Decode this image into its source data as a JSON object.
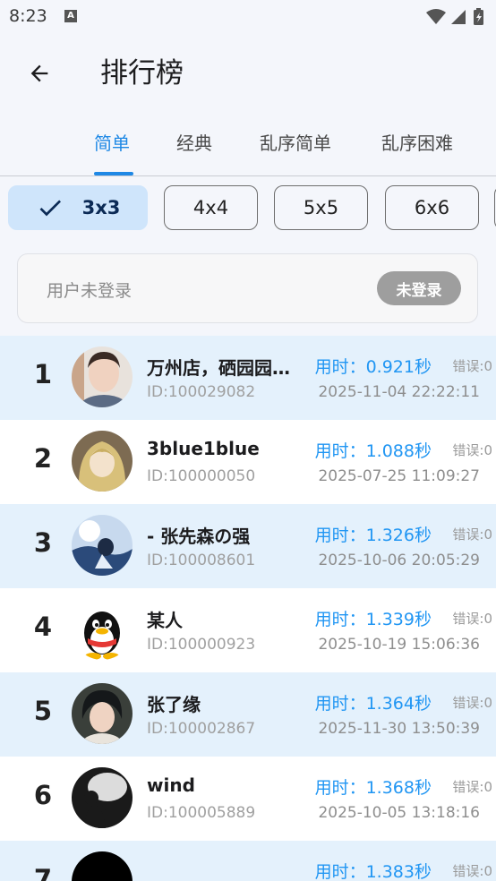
{
  "status_bar": {
    "time": "8:23",
    "notification_icon": "a-icon"
  },
  "header": {
    "title": "排行榜",
    "back_icon": "arrow-left-icon"
  },
  "tabs": [
    {
      "label": "简单",
      "active": true
    },
    {
      "label": "经典",
      "active": false
    },
    {
      "label": "乱序简单",
      "active": false
    },
    {
      "label": "乱序困难",
      "active": false
    }
  ],
  "sizes": [
    {
      "label": "3x3",
      "selected": true
    },
    {
      "label": "4x4",
      "selected": false
    },
    {
      "label": "5x5",
      "selected": false
    },
    {
      "label": "6x6",
      "selected": false
    }
  ],
  "login": {
    "text": "用户未登录",
    "button_label": "未登录"
  },
  "leaderboard": [
    {
      "rank": "1",
      "name": "万州店，硒园园…",
      "id": "ID:100029082",
      "time": "用时：0.921秒",
      "errors": "错误:0",
      "date": "2025-11-04 22:22:11"
    },
    {
      "rank": "2",
      "name": "3blue1blue",
      "id": "ID:100000050",
      "time": "用时：1.088秒",
      "errors": "错误:0",
      "date": "2025-07-25 11:09:27"
    },
    {
      "rank": "3",
      "name": "- 张先森の强",
      "id": "ID:100008601",
      "time": "用时：1.326秒",
      "errors": "错误:0",
      "date": "2025-10-06 20:05:29"
    },
    {
      "rank": "4",
      "name": "某人",
      "id": "ID:100000923",
      "time": "用时：1.339秒",
      "errors": "错误:0",
      "date": "2025-10-19 15:06:36"
    },
    {
      "rank": "5",
      "name": "张了缘",
      "id": "ID:100002867",
      "time": "用时：1.364秒",
      "errors": "错误:0",
      "date": "2025-11-30 13:50:39"
    },
    {
      "rank": "6",
      "name": "wind",
      "id": "ID:100005889",
      "time": "用时：1.368秒",
      "errors": "错误:0",
      "date": "2025-10-05 13:18:16"
    },
    {
      "rank": "7",
      "name": "",
      "id": "",
      "time": "用时：1.383秒",
      "errors": "错误:0",
      "date": ""
    }
  ],
  "colors": {
    "accent": "#1e88e5",
    "row_shaded": "#e4f1fc",
    "chip_selected": "#cfe5fb"
  }
}
